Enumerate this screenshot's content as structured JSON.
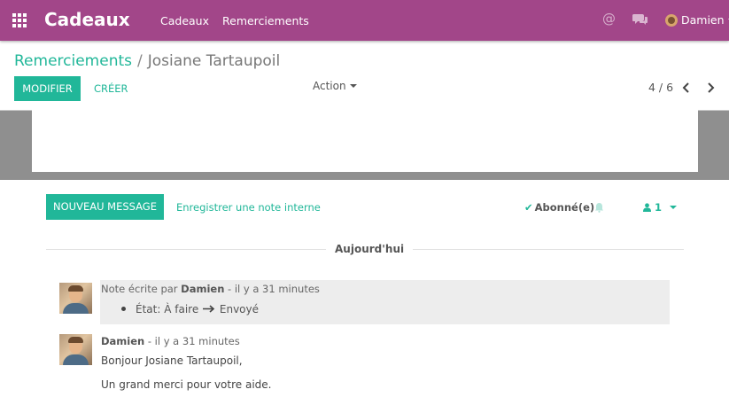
{
  "app": {
    "title": "Cadeaux",
    "menus": [
      "Cadeaux",
      "Remerciements"
    ],
    "brand_color": "#a24689",
    "accent_color": "#21b799"
  },
  "systray": {
    "mentions_icon": "@",
    "user_name": "Damien"
  },
  "breadcrumb": {
    "parent": "Remerciements",
    "separator": "/",
    "current": "Josiane Tartaupoil"
  },
  "buttons": {
    "edit": "MODIFIER",
    "create": "CRÉER",
    "action": "Action"
  },
  "pager": {
    "value": "4 / 6"
  },
  "chatter": {
    "new_message": "NOUVEAU MESSAGE",
    "log_note": "Enregistrer une note interne",
    "follow_status": "Abonné(e)",
    "followers_count": "1",
    "day_separator": "Aujourd'hui",
    "messages": [
      {
        "prefix": "Note écrite par",
        "author": "Damien",
        "date": "- il y a 31 minutes",
        "tracking": {
          "field": "État:",
          "old_value": "À faire",
          "new_value": "Envoyé"
        }
      },
      {
        "author": "Damien",
        "date": "- il y a 31 minutes",
        "body": [
          "Bonjour Josiane Tartaupoil,",
          "Un grand merci pour votre aide."
        ]
      }
    ]
  }
}
